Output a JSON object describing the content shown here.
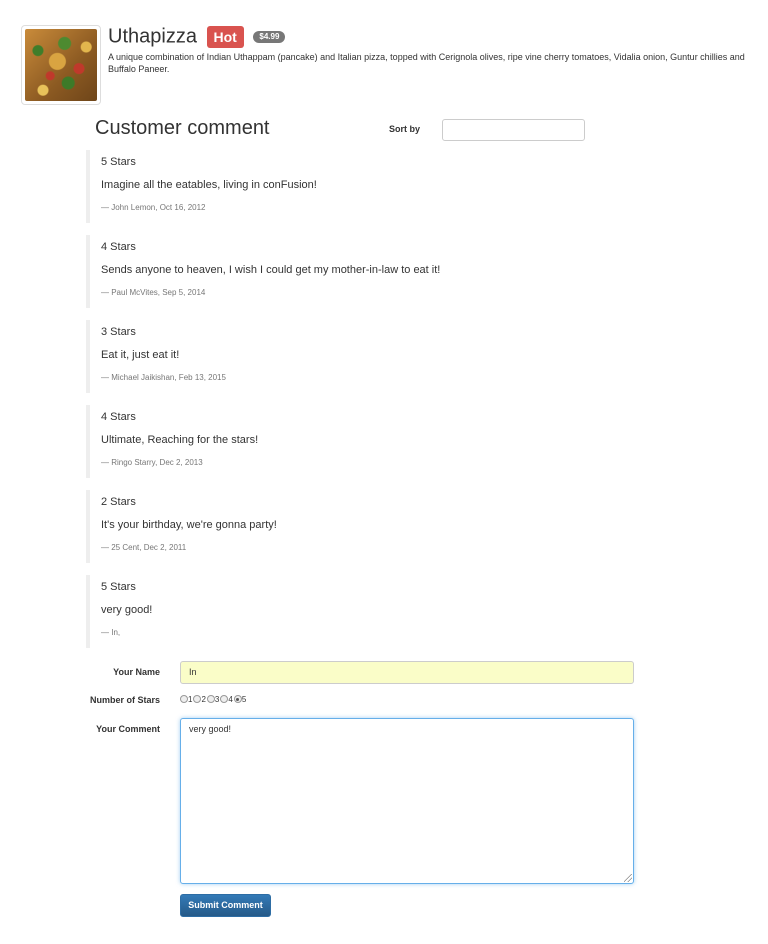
{
  "dish": {
    "name": "Uthapizza",
    "label": "Hot",
    "price": "$4.99",
    "description": "A unique combination of Indian Uthappam (pancake) and Italian pizza, topped with Cerignola olives, ripe vine cherry tomatoes, Vidalia onion, Guntur chillies and Buffalo Paneer.",
    "image_icon": "pizza-image"
  },
  "comments_section": {
    "title": "Customer comment",
    "sort_label": "Sort by",
    "sort_value": ""
  },
  "comments": [
    {
      "stars": "5 Stars",
      "text": "Imagine all the eatables, living in conFusion!",
      "meta": "— John Lemon, Oct 16, 2012"
    },
    {
      "stars": "4 Stars",
      "text": "Sends anyone to heaven, I wish I could get my mother-in-law to eat it!",
      "meta": "— Paul McVites, Sep 5, 2014"
    },
    {
      "stars": "3 Stars",
      "text": "Eat it, just eat it!",
      "meta": "— Michael Jaikishan, Feb 13, 2015"
    },
    {
      "stars": "4 Stars",
      "text": "Ultimate, Reaching for the stars!",
      "meta": "— Ringo Starry, Dec 2, 2013"
    },
    {
      "stars": "2 Stars",
      "text": "It's your birthday, we're gonna party!",
      "meta": "— 25 Cent, Dec 2, 2011"
    },
    {
      "stars": "5 Stars",
      "text": "very good!",
      "meta": "— In,"
    }
  ],
  "form": {
    "name_label": "Your Name",
    "name_value": "In",
    "stars_label": "Number of Stars",
    "star_options": [
      "1",
      "2",
      "3",
      "4",
      "5"
    ],
    "selected_star": "5",
    "comment_label": "Your Comment",
    "comment_value": "very good!",
    "submit_label": "Submit Comment"
  },
  "colors": {
    "hot_label": "#d9534f",
    "price_badge": "#777777",
    "name_input_bg": "#fafdc8",
    "focus_border": "#66afe9",
    "submit_button": "#337ab7"
  }
}
